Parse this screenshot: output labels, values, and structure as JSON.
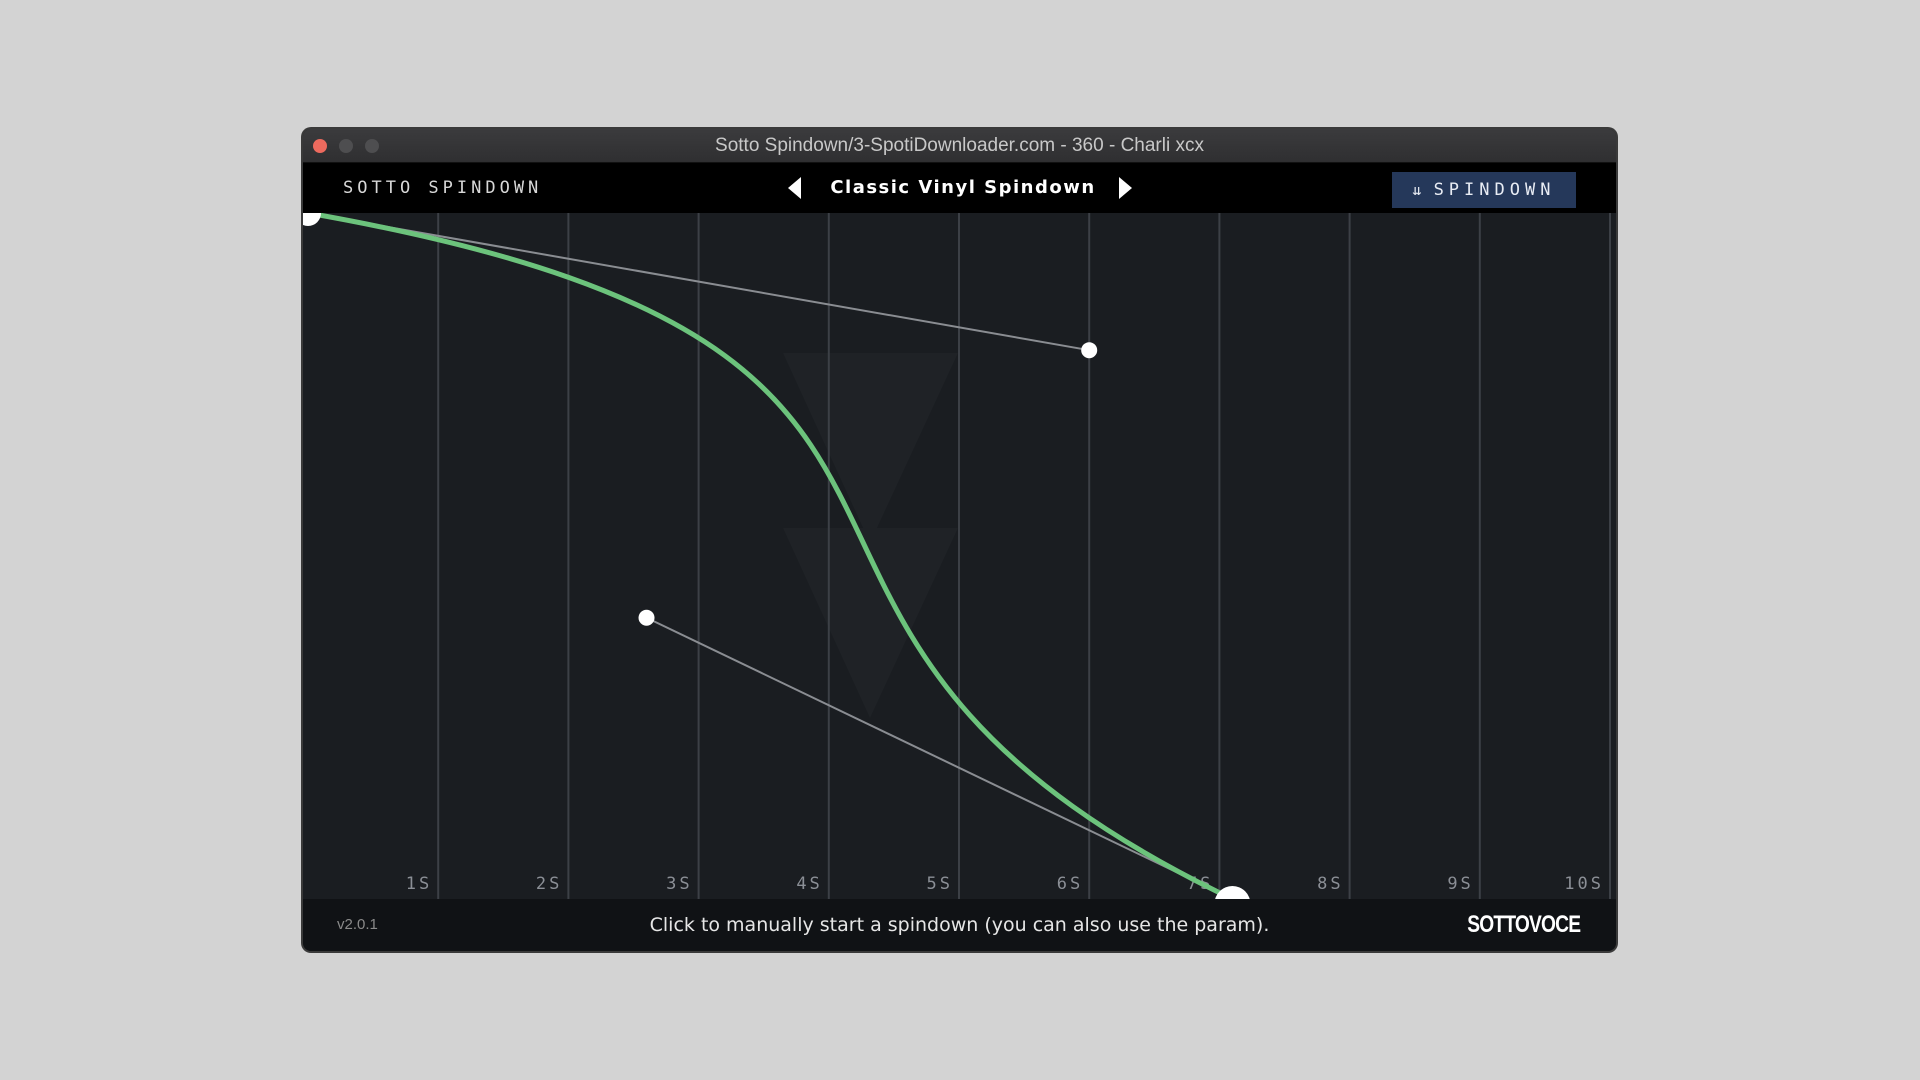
{
  "window": {
    "title": "Sotto Spindown/3-SpotiDownloader.com - 360 - Charli xcx"
  },
  "header": {
    "brand": "SOTTO SPINDOWN",
    "preset_name": "Classic Vinyl Spindown",
    "spindown_label": "SPINDOWN"
  },
  "graph": {
    "time_labels": [
      "1S",
      "2S",
      "3S",
      "4S",
      "5S",
      "6S",
      "7S",
      "8S",
      "9S",
      "10S"
    ],
    "time_seconds": [
      1,
      2,
      3,
      4,
      5,
      6,
      7,
      8,
      9,
      10
    ],
    "curve_color": "#6cc37c",
    "end_time_seconds": 7.1,
    "control_points": [
      {
        "t": 6.0,
        "level": 0.8
      },
      {
        "t": 2.6,
        "level": 0.41
      }
    ]
  },
  "footer": {
    "version": "v2.0.1",
    "hint": "Click to manually start a spindown (you can also use the param).",
    "logo": "SOTTOVOCE"
  },
  "icons": {
    "spindown": "double-chevron-down-icon",
    "prev": "triangle-left-icon",
    "next": "triangle-right-icon"
  }
}
